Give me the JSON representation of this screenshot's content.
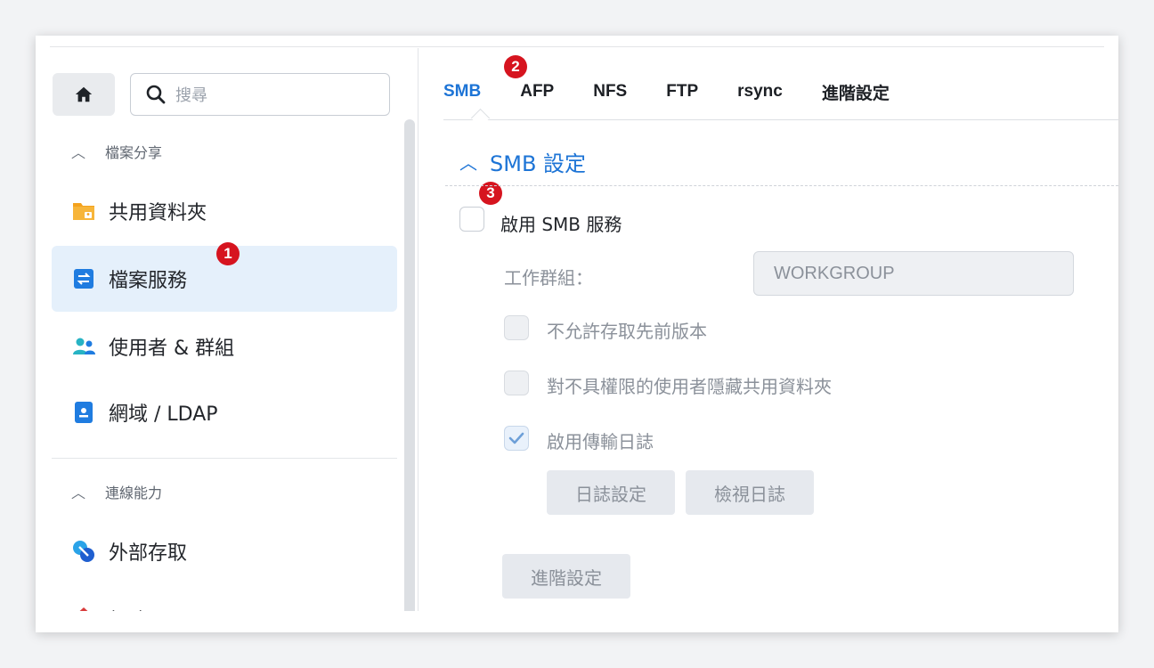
{
  "sidebar": {
    "search_placeholder": "搜尋",
    "section_file_sharing": "檔案分享",
    "items": [
      {
        "label": "共用資料夾"
      },
      {
        "label": "檔案服務"
      },
      {
        "label": "使用者 & 群組"
      },
      {
        "label": "網域 / LDAP"
      }
    ],
    "section_connectivity": "連線能力",
    "items2": [
      {
        "label": "外部存取"
      },
      {
        "label": "網路"
      }
    ]
  },
  "tabs": [
    "SMB",
    "AFP",
    "NFS",
    "FTP",
    "rsync",
    "進階設定"
  ],
  "badges": [
    "1",
    "2",
    "3"
  ],
  "smb": {
    "section_title": "SMB 設定",
    "enable_label": "啟用 SMB 服務",
    "workgroup_label": "工作群組：",
    "workgroup_value": "WORKGROUP",
    "opt_prev_versions": "不允許存取先前版本",
    "opt_hide_folders": "對不具權限的使用者隱藏共用資料夾",
    "opt_transfer_log": "啟用傳輸日誌",
    "btn_log_settings": "日誌設定",
    "btn_view_logs": "檢視日誌",
    "btn_advanced": "進階設定"
  },
  "colors": {
    "accent": "#1d74d6",
    "badge": "#d6141f",
    "active_bg": "#e5f0fb"
  }
}
